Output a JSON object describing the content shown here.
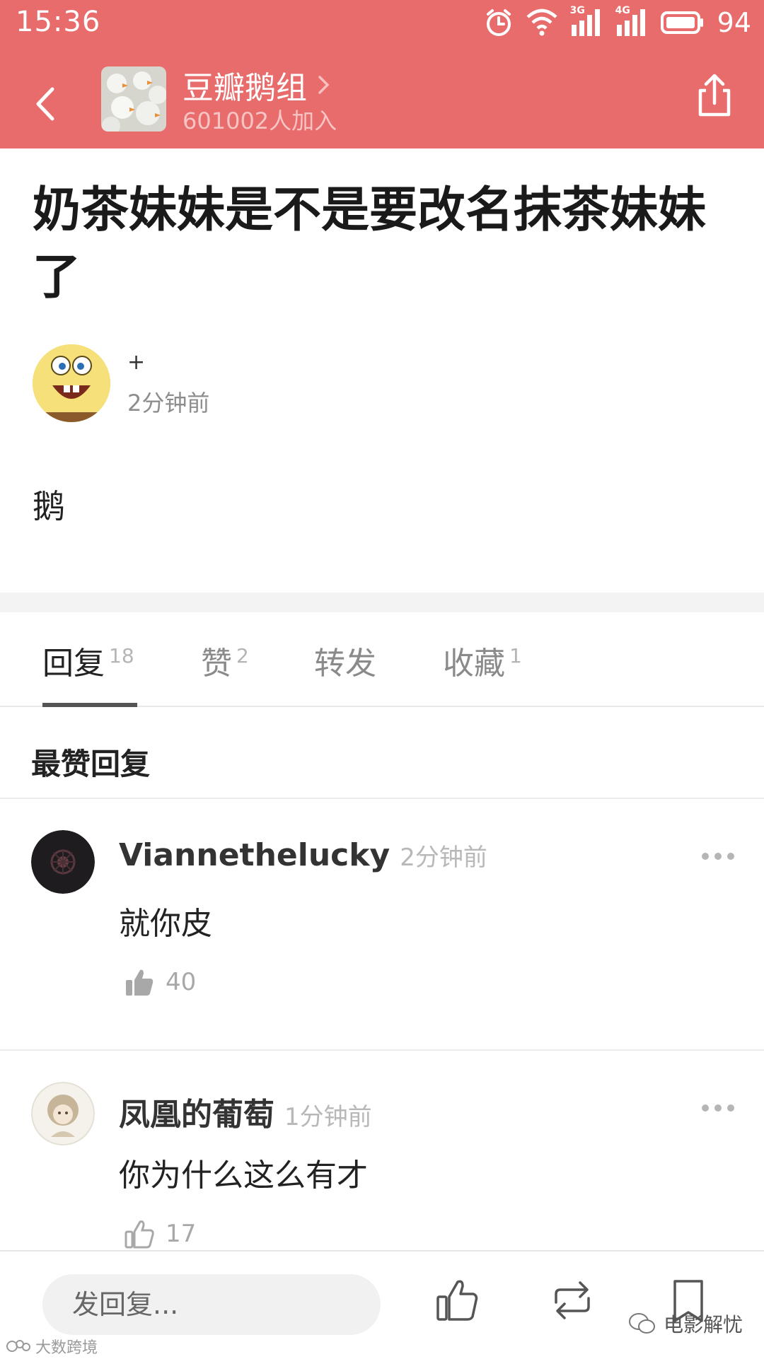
{
  "status_bar": {
    "time": "15:36",
    "net1": "3G",
    "net2": "4G",
    "battery": "94"
  },
  "group": {
    "name": "豆瓣鹅组",
    "members": "601002人加入"
  },
  "post": {
    "title": "奶茶妹妹是不是要改名抹茶妹妹了",
    "author_name": "+",
    "time": "2分钟前",
    "body": "鹅"
  },
  "tabs": [
    {
      "label": "回复",
      "count": "18"
    },
    {
      "label": "赞",
      "count": "2"
    },
    {
      "label": "转发",
      "count": ""
    },
    {
      "label": "收藏",
      "count": "1"
    }
  ],
  "section_title": "最赞回复",
  "comments": [
    {
      "name": "Viannethelucky",
      "time": "2分钟前",
      "text": "就你皮",
      "likes": "40"
    },
    {
      "name": "凤凰的葡萄",
      "time": "1分钟前",
      "text": "你为什么这么有才",
      "likes": "17"
    }
  ],
  "bottom_bar": {
    "reply_placeholder": "发回复..."
  },
  "watermarks": {
    "right": "电影解忧",
    "left": "大数跨境"
  },
  "colors": {
    "header_bg": "#e86c6c",
    "tab_underline": "#555555"
  }
}
